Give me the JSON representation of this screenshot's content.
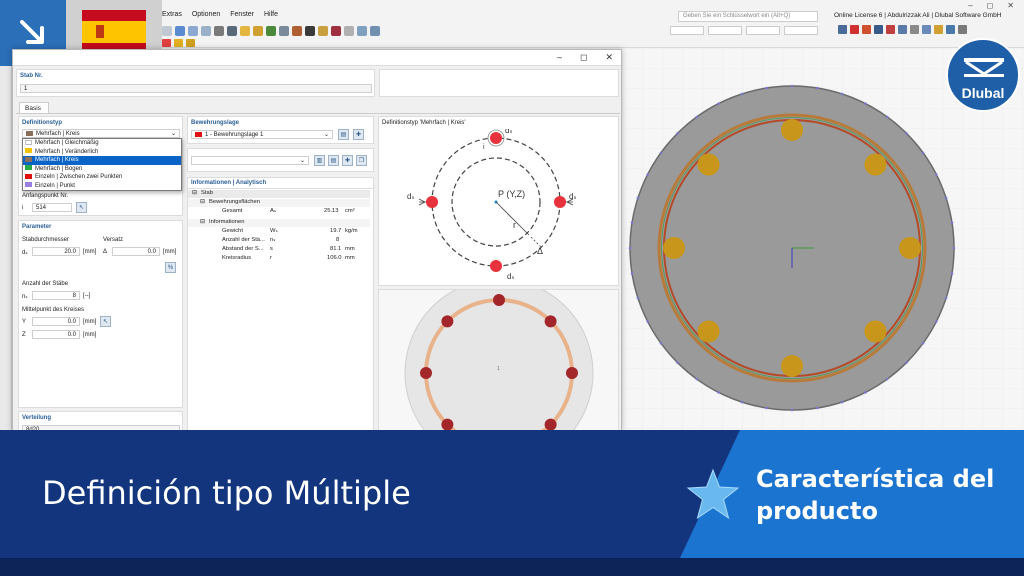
{
  "menu": [
    "Extras",
    "Optionen",
    "Fenster",
    "Hilfe"
  ],
  "search": {
    "placeholder": "Geben Sie ein Schlüsselwort ein (Alt+Q)"
  },
  "license": "Online License 6 | Abdulrizzak Ali | Dlubal Software GmbH",
  "window_controls": [
    "–",
    "◻",
    "✕"
  ],
  "dialog": {
    "window_controls": [
      "–",
      "◻",
      "✕"
    ],
    "stab_label": "Stab Nr.",
    "stab_value": "1",
    "tab": "Basis",
    "definitionstyp": {
      "label": "Definitionstyp",
      "selected": "Mehrfach | Kreis",
      "options": [
        {
          "label": "Mehrfach | Gleichmäßig",
          "color": "#ffffff"
        },
        {
          "label": "Mehrfach | Veränderlich",
          "color": "#f5c400"
        },
        {
          "label": "Mehrfach | Kreis",
          "color": "#8a6f5a"
        },
        {
          "label": "Mehrfach | Bogen",
          "color": "#27a84a"
        },
        {
          "label": "Einzeln | Zwischen zwei Punkten",
          "color": "#e01010"
        },
        {
          "label": "Einzeln | Punkt",
          "color": "#9b7fe0"
        }
      ]
    },
    "anfangspunkt_label": "Anfangspunkt Nr.",
    "anfangspunkt_sym": "i",
    "anfangspunkt_value": "514",
    "bewehrungslage": {
      "label": "Bewehrungslage",
      "value": "1 - Bewehrungslage 1"
    },
    "parameter": {
      "label": "Parameter",
      "stabdurchmesser_label": "Stabdurchmesser",
      "versatz_label": "Versatz",
      "ds_sym": "dₛ",
      "ds_value": "20.0",
      "ds_unit": "[mm]",
      "delta_sym": "Δ",
      "delta_value": "0.0",
      "delta_unit": "[mm]",
      "percent_btn": "%",
      "anzahl_label": "Anzahl der Stäbe",
      "n_sym": "nₛ",
      "n_value": "8",
      "n_unit": "[--]",
      "mittelpunkt_label": "Mittelpunkt des Kreises",
      "y_sym": "Y",
      "y_value": "0.0",
      "y_unit": "[mm]",
      "z_sym": "Z",
      "z_value": "0.0",
      "z_unit": "[mm]"
    },
    "verteilung": {
      "label": "Verteilung",
      "value": "8d20"
    },
    "info": {
      "title": "Informationen | Analytisch",
      "rows": [
        {
          "name": "Stab",
          "sym": "",
          "val": "",
          "unit": ""
        },
        {
          "name": "Bewehrungsflächen",
          "sym": "",
          "val": "",
          "unit": ""
        },
        {
          "name": "Gesamt",
          "sym": "Aₛ",
          "val": "25.13",
          "unit": "cm²"
        },
        {
          "name": "Informationen",
          "sym": "",
          "val": "",
          "unit": ""
        },
        {
          "name": "Gewicht",
          "sym": "Wₛ",
          "val": "19.7",
          "unit": "kg/m"
        },
        {
          "name": "Anzahl der Stä...",
          "sym": "nₛ",
          "val": "8",
          "unit": ""
        },
        {
          "name": "Abstand der S...",
          "sym": "s",
          "val": "81.1",
          "unit": "mm"
        },
        {
          "name": "Kreisradius",
          "sym": "r",
          "val": "106.0",
          "unit": "mm"
        }
      ]
    },
    "diagram": {
      "title": "Definitionstyp 'Mehrfach | Kreis'",
      "labels": {
        "ds": "dₛ",
        "i": "i",
        "p": "P (Y,Z)",
        "r": "r",
        "delta": "Δ"
      }
    }
  },
  "banner": {
    "title": "Definición tipo Múltiple",
    "tag_line1": "Característica del",
    "tag_line2": "producto"
  },
  "logo": "Dlubal",
  "colors": {
    "accent": "#0a64c8",
    "banner": "#13357d",
    "banner_accent": "#1b74d0",
    "rebar": "#a3262a",
    "rebar_3d": "#c8961a"
  }
}
